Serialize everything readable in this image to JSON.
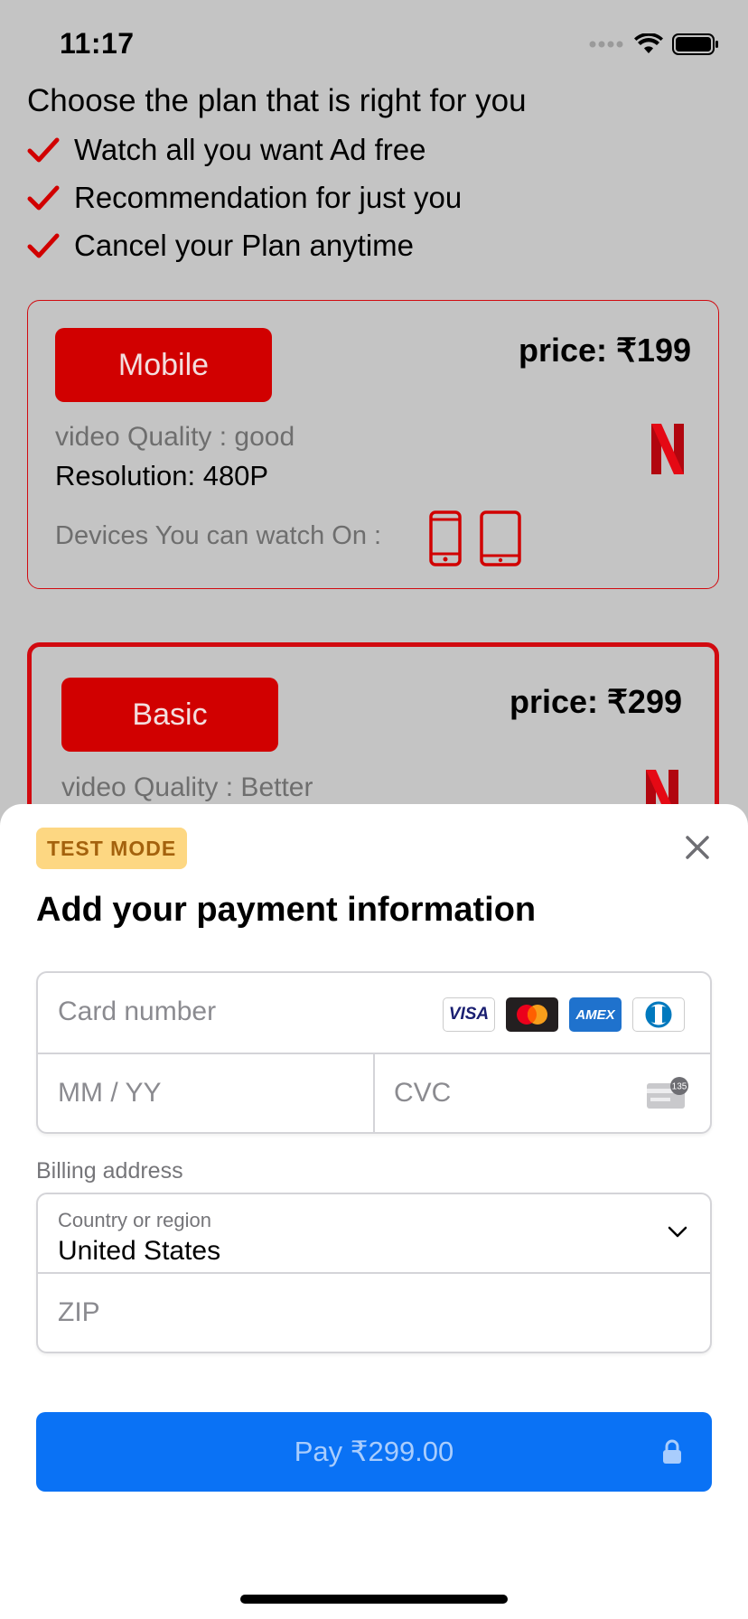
{
  "status_bar": {
    "time": "11:17"
  },
  "header": {
    "headline": "Choose the plan that is right for you",
    "features": [
      "Watch all you want Ad free",
      "Recommendation for just you",
      "Cancel your Plan anytime"
    ]
  },
  "plans": [
    {
      "name": "Mobile",
      "price": "price: ₹199",
      "quality": "video Quality : good",
      "resolution": "Resolution: 480P",
      "devices_label": "Devices You can watch On :"
    },
    {
      "name": "Basic",
      "price": "price: ₹299",
      "quality": "video Quality : Better"
    }
  ],
  "sheet": {
    "badge": "TEST MODE",
    "title": "Add your payment information",
    "card_number_placeholder": "Card number",
    "expiry_placeholder": "MM / YY",
    "cvc_placeholder": "CVC",
    "cvc_hint": "135",
    "card_brands": [
      "VISA",
      "Mastercard",
      "AMEX",
      "Diners Club"
    ],
    "billing_label": "Billing address",
    "country_label": "Country or region",
    "country_value": "United States",
    "zip_placeholder": "ZIP",
    "pay_label": "Pay ₹299.00"
  },
  "colors": {
    "accent_red": "#d10000",
    "pay_blue": "#0a72f5",
    "badge_bg": "#fdd782"
  }
}
